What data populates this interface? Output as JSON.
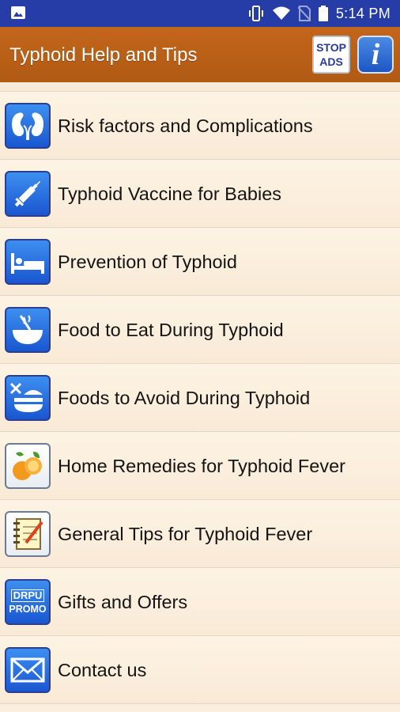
{
  "status_bar": {
    "time": "5:14 PM",
    "icons": [
      "image-icon",
      "vibrate-icon",
      "wifi-icon",
      "no-sim-icon",
      "battery-icon"
    ]
  },
  "app_bar": {
    "title": "Typhoid Help and Tips",
    "stop_ads_line1": "STOP",
    "stop_ads_line2": "ADS",
    "info_label": "i"
  },
  "menu": {
    "items": [
      {
        "label": "",
        "icon": "partial-icon"
      },
      {
        "label": "Risk factors and Complications",
        "icon": "kidney-icon"
      },
      {
        "label": "Typhoid Vaccine for Babies",
        "icon": "syringe-icon"
      },
      {
        "label": "Prevention of Typhoid",
        "icon": "bed-icon"
      },
      {
        "label": "Food to Eat During Typhoid",
        "icon": "bowl-icon"
      },
      {
        "label": "Foods to Avoid During Typhoid",
        "icon": "burger-cross-icon"
      },
      {
        "label": "Home Remedies for Typhoid Fever",
        "icon": "orange-fruit-icon"
      },
      {
        "label": "General Tips for Typhoid Fever",
        "icon": "notepad-icon"
      },
      {
        "label": "Gifts and Offers",
        "icon": "drpu-promo-icon",
        "promo_line1": "DRPU",
        "promo_line2": "PROMO"
      },
      {
        "label": "Contact us",
        "icon": "envelope-icon"
      }
    ]
  },
  "colors": {
    "status_bar": "#263da8",
    "app_bar": "#b8601a",
    "list_background": "#fbeedd",
    "icon_blue": "#1a56d0"
  }
}
